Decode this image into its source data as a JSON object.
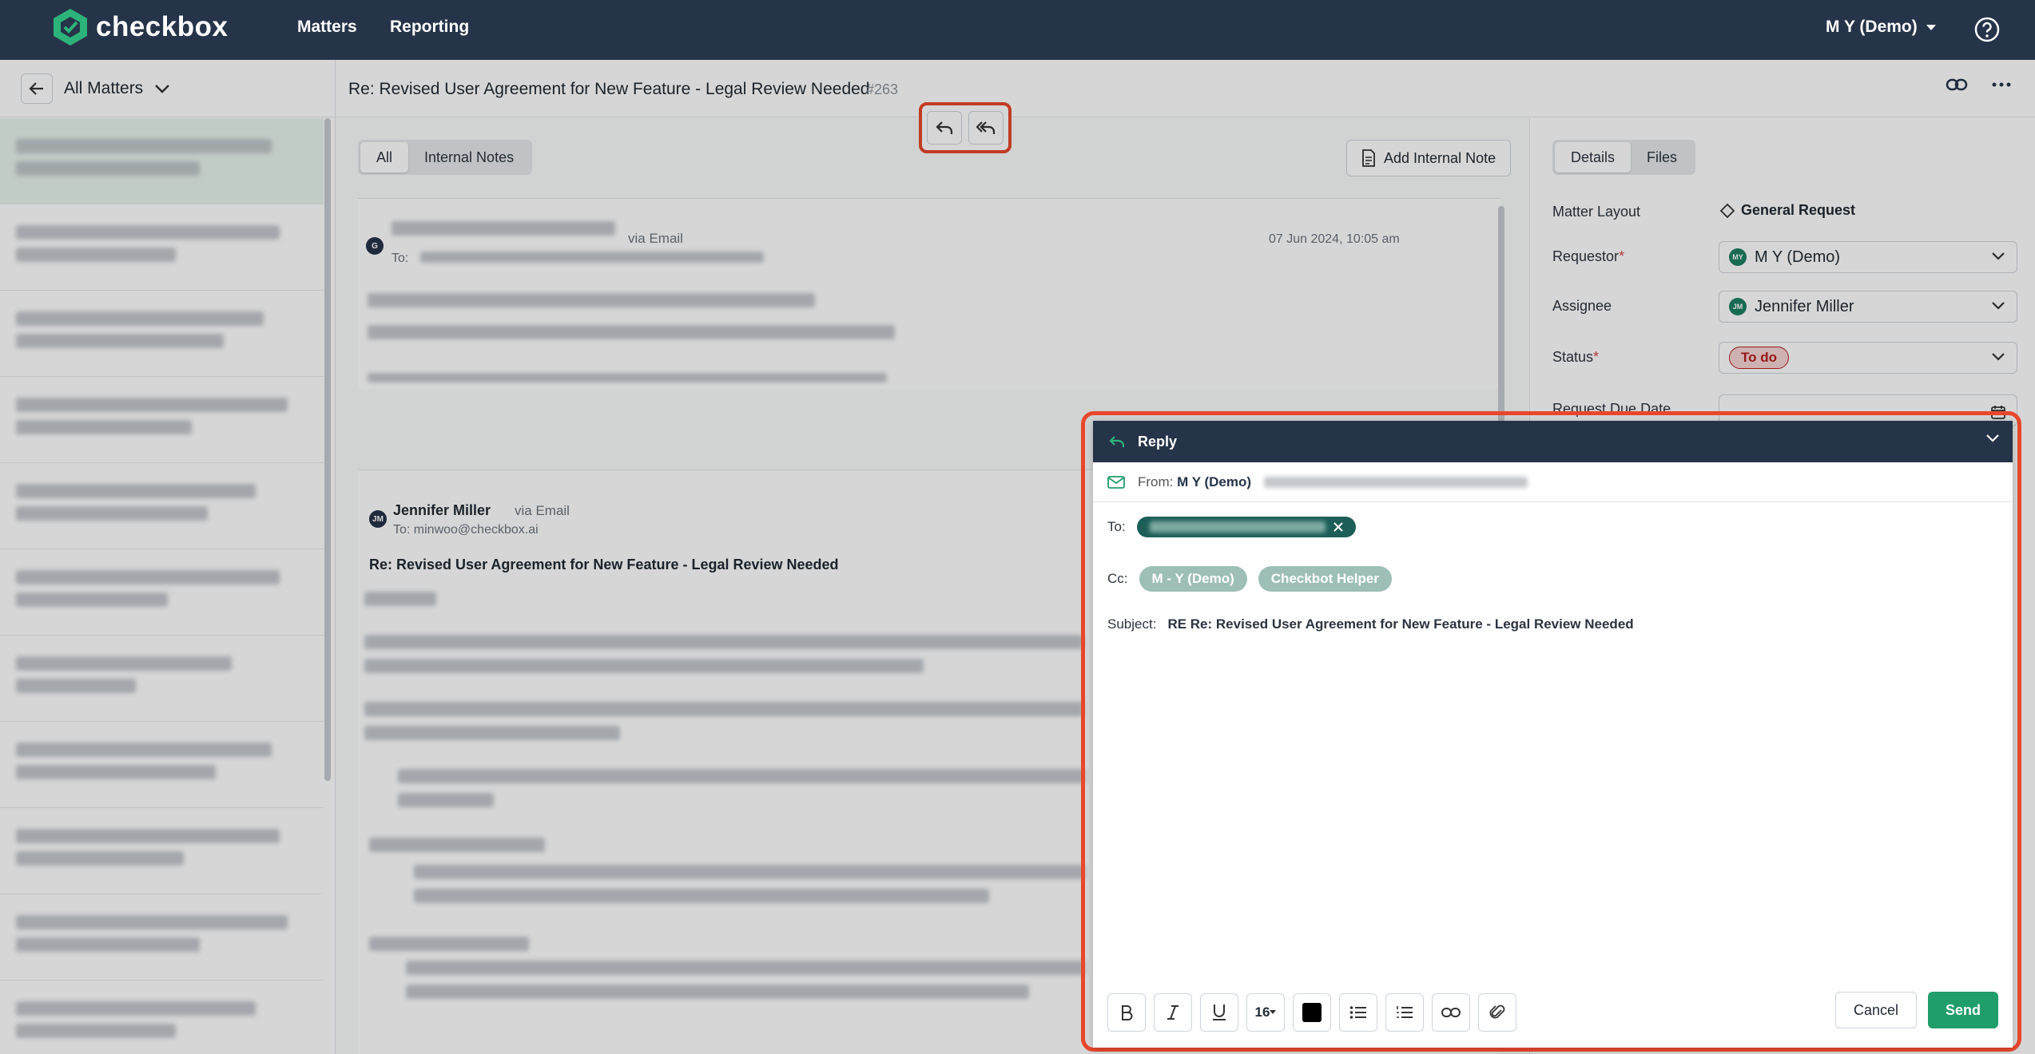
{
  "topnav": {
    "logo_text": "checkbox",
    "links": [
      "Matters",
      "Reporting"
    ],
    "user": "M Y (Demo)"
  },
  "left_pane": {
    "title": "All Matters"
  },
  "matter": {
    "title": "Re: Revised User Agreement for New Feature - Legal Review Needed",
    "number": "#263"
  },
  "thread": {
    "tabs": [
      "All",
      "Internal Notes"
    ],
    "add_note_label": "Add Internal Note",
    "messages": [
      {
        "avatar": "G",
        "via": "via Email",
        "to": "To: ",
        "date": "07 Jun 2024, 10:05 am"
      },
      {
        "avatar": "JM",
        "sender": "Jennifer Miller",
        "via": "via Email",
        "to": "To: minwoo@checkbox.ai",
        "subject": "Re: Revised User Agreement for New Feature - Legal Review Needed"
      }
    ]
  },
  "details": {
    "tabs": [
      "Details",
      "Files"
    ],
    "fields": {
      "layout_label": "Matter Layout",
      "layout_value": "General Request",
      "requestor_label": "Requestor",
      "requestor_initials": "MY",
      "requestor_value": "M Y (Demo)",
      "assignee_label": "Assignee",
      "assignee_initials": "JM",
      "assignee_value": "Jennifer Miller",
      "status_label": "Status",
      "status_value": "To do",
      "due_label": "Request Due Date",
      "required_mark": "*"
    }
  },
  "reply": {
    "title": "Reply",
    "from_label": "From:",
    "from_name": "M Y (Demo)",
    "to_label": "To:",
    "cc_label": "Cc:",
    "cc": [
      "M - Y (Demo)",
      "Checkbot Helper"
    ],
    "subject_label": "Subject:",
    "subject_value": "RE Re: Revised User Agreement for New Feature - Legal Review Needed",
    "font_size": "16",
    "cancel_label": "Cancel",
    "send_label": "Send"
  },
  "colors": {
    "nav": "#263449",
    "brand_green": "#1f9d6b",
    "highlight": "#e8472c"
  }
}
